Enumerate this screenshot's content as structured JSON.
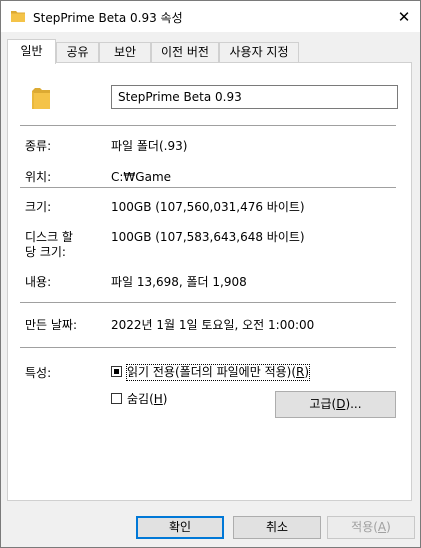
{
  "window": {
    "title": "StepPrime Beta 0.93 속성",
    "close_glyph": "✕"
  },
  "tabs": [
    {
      "label": "일반",
      "active": true
    },
    {
      "label": "공유",
      "active": false
    },
    {
      "label": "보안",
      "active": false
    },
    {
      "label": "이전 버전",
      "active": false
    },
    {
      "label": "사용자 지정",
      "active": false
    }
  ],
  "general": {
    "folder_name": "StepPrime Beta 0.93",
    "type_label": "종류:",
    "type_value": "파일 폴더(.93)",
    "location_label": "위치:",
    "location_value": "C:₩Game",
    "size_label": "크기:",
    "size_value": "100GB (107,560,031,476 바이트)",
    "disk_size_label_line1": "디스크 할",
    "disk_size_label_line2": "당 크기:",
    "disk_size_value": "100GB (107,583,643,648 바이트)",
    "contains_label": "내용:",
    "contains_value": "파일 13,698, 폴더 1,908",
    "created_label": "만든 날짜:",
    "created_value": "2022년 1월 1일 토요일, 오전 1:00:00",
    "attributes_label": "특성:",
    "readonly_label_text": "읽기 전용(폴더의 파일에만 적용)(",
    "readonly_mnemonic": "R",
    "readonly_state": "mixed",
    "hidden_label_text": "숨김(",
    "hidden_mnemonic": "H",
    "hidden_state": "unchecked",
    "advanced_text": "고급(",
    "advanced_mnemonic": "D",
    "advanced_suffix": ")..."
  },
  "footer": {
    "ok_label": "확인",
    "cancel_label": "취소",
    "apply_text": "적용(",
    "apply_mnemonic": "A"
  },
  "colors": {
    "folder": "#f4c348",
    "default_button_border": "#0078d7"
  }
}
